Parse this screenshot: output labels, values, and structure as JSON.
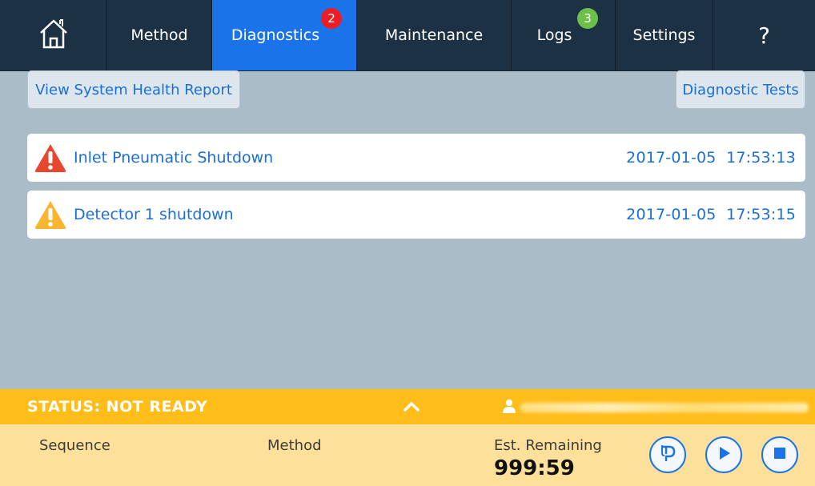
{
  "nav": {
    "home_icon": "home-icon",
    "tabs": [
      {
        "label": "Method",
        "active": false
      },
      {
        "label": "Diagnostics",
        "active": true,
        "badge": "2"
      },
      {
        "label": "Maintenance",
        "active": false
      },
      {
        "label": "Logs",
        "active": false,
        "badge": "3"
      },
      {
        "label": "Settings",
        "active": false
      }
    ],
    "help_label": "?"
  },
  "toolbar": {
    "health_report_label": "View System Health Report",
    "diagnostic_tests_label": "Diagnostic Tests"
  },
  "alerts": [
    {
      "severity": "error",
      "icon": "error-warning-icon",
      "message": "Inlet Pneumatic Shutdown",
      "date": "2017-01-05",
      "time": "17:53:13"
    },
    {
      "severity": "warning",
      "icon": "warning-icon",
      "message": "Detector 1 shutdown",
      "date": "2017-01-05",
      "time": "17:53:15"
    }
  ],
  "status": {
    "text": "STATUS: NOT READY",
    "user_icon": "user-icon"
  },
  "bottom": {
    "sequence_label": "Sequence",
    "method_label": "Method",
    "remaining_label": "Est. Remaining",
    "remaining_value": "999:59"
  },
  "colors": {
    "nav_bg": "#1d3144",
    "active_tab": "#1a73e8",
    "status_bar": "#ffbd1a",
    "bottom_panel": "#fde19b",
    "link_blue": "#1a6fd6",
    "error_red": "#e8472f",
    "warning_amber": "#f8b530"
  }
}
